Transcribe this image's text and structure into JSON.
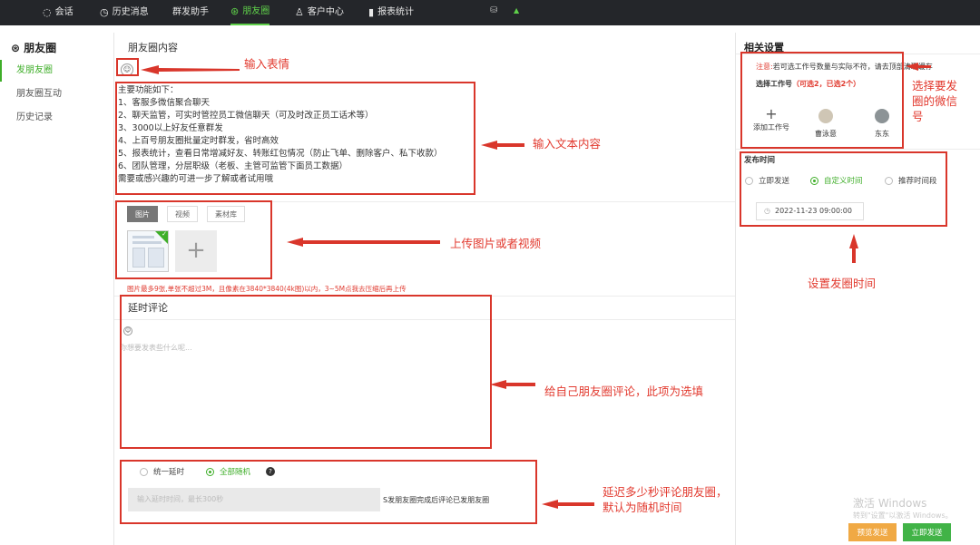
{
  "topbar": {
    "tabs": [
      {
        "icon": "chat-icon",
        "label": "会话"
      },
      {
        "icon": "clock-icon",
        "label": "历史消息"
      },
      {
        "icon": "",
        "label": "群发助手"
      },
      {
        "icon": "moments-icon",
        "label": "朋友圈",
        "active": true
      },
      {
        "icon": "user-icon",
        "label": "客户中心"
      },
      {
        "icon": "bar-chart-icon",
        "label": "报表统计"
      }
    ]
  },
  "sidebar": {
    "title": "朋友圈",
    "items": [
      {
        "label": "发朋友圈",
        "active": true
      },
      {
        "label": "朋友圈互动"
      },
      {
        "label": "历史记录"
      }
    ]
  },
  "main": {
    "title": "朋友圈内容",
    "content_text": "主要功能如下：\n1、客服多微信聚合聊天\n2、聊天监管，可实时管控员工微信聊天（可及时改正员工话术等）\n3、3000以上好友任意群发\n4、上百号朋友圈批量定时群发，省时高效\n5、报表统计，查看日常增减好友、转账红包情况（防止飞单、删除客户、私下收款）\n6、团队管理，分层职级（老板、主管可监管下面员工数据）\n需要或感兴趣的可进一步了解或者试用哦",
    "media_tabs": [
      "图片",
      "视频",
      "素材库"
    ],
    "upload_hint": "图片最多9张,单张不超过3M，且像素在3840*3840(4k图)以内，3~5M点我去压缩后再上传",
    "delay_title": "延时评论",
    "comment_placeholder": "你想要发表些什么呢...",
    "delay_options": [
      "统一延时",
      "全部随机"
    ],
    "seconds_placeholder": "输入延时时间，最长300秒",
    "seconds_suffix": "S发朋友圈完成后评论已发朋友圈"
  },
  "right": {
    "title": "相关设置",
    "notice_red": "注意:",
    "notice_text": "若可选工作号数量与实际不符，请去顶部清理缓存",
    "select_label": "选择工作号",
    "select_hint": "（可选2，已选2个）",
    "accounts": [
      {
        "name": "添加工作号"
      },
      {
        "name": "曹泳意"
      },
      {
        "name": "东东"
      }
    ],
    "publish_title": "发布时间",
    "publish_options": [
      "立即发送",
      "自定义时间",
      "推荐时间段"
    ],
    "datetime": "2022-11-23 09:00:00",
    "buttons": {
      "schedule": "预览发送",
      "send": "立即发送"
    },
    "watermark_line1": "激活 Windows",
    "watermark_line2": "转到\"设置\"以激活 Windows。"
  },
  "annotations": {
    "emoji": "输入表情",
    "text": "输入文本内容",
    "upload": "上传图片或者视频",
    "comment": "给自己朋友圈评论，此项为选填",
    "delay": "延迟多少秒评论朋友圈，默认为随机时间",
    "account": "选择要发圈的微信号",
    "time": "设置发圈时间"
  },
  "colors": {
    "accent": "#3fae29",
    "annotation": "#d9362b",
    "topbar": "#24262a"
  }
}
